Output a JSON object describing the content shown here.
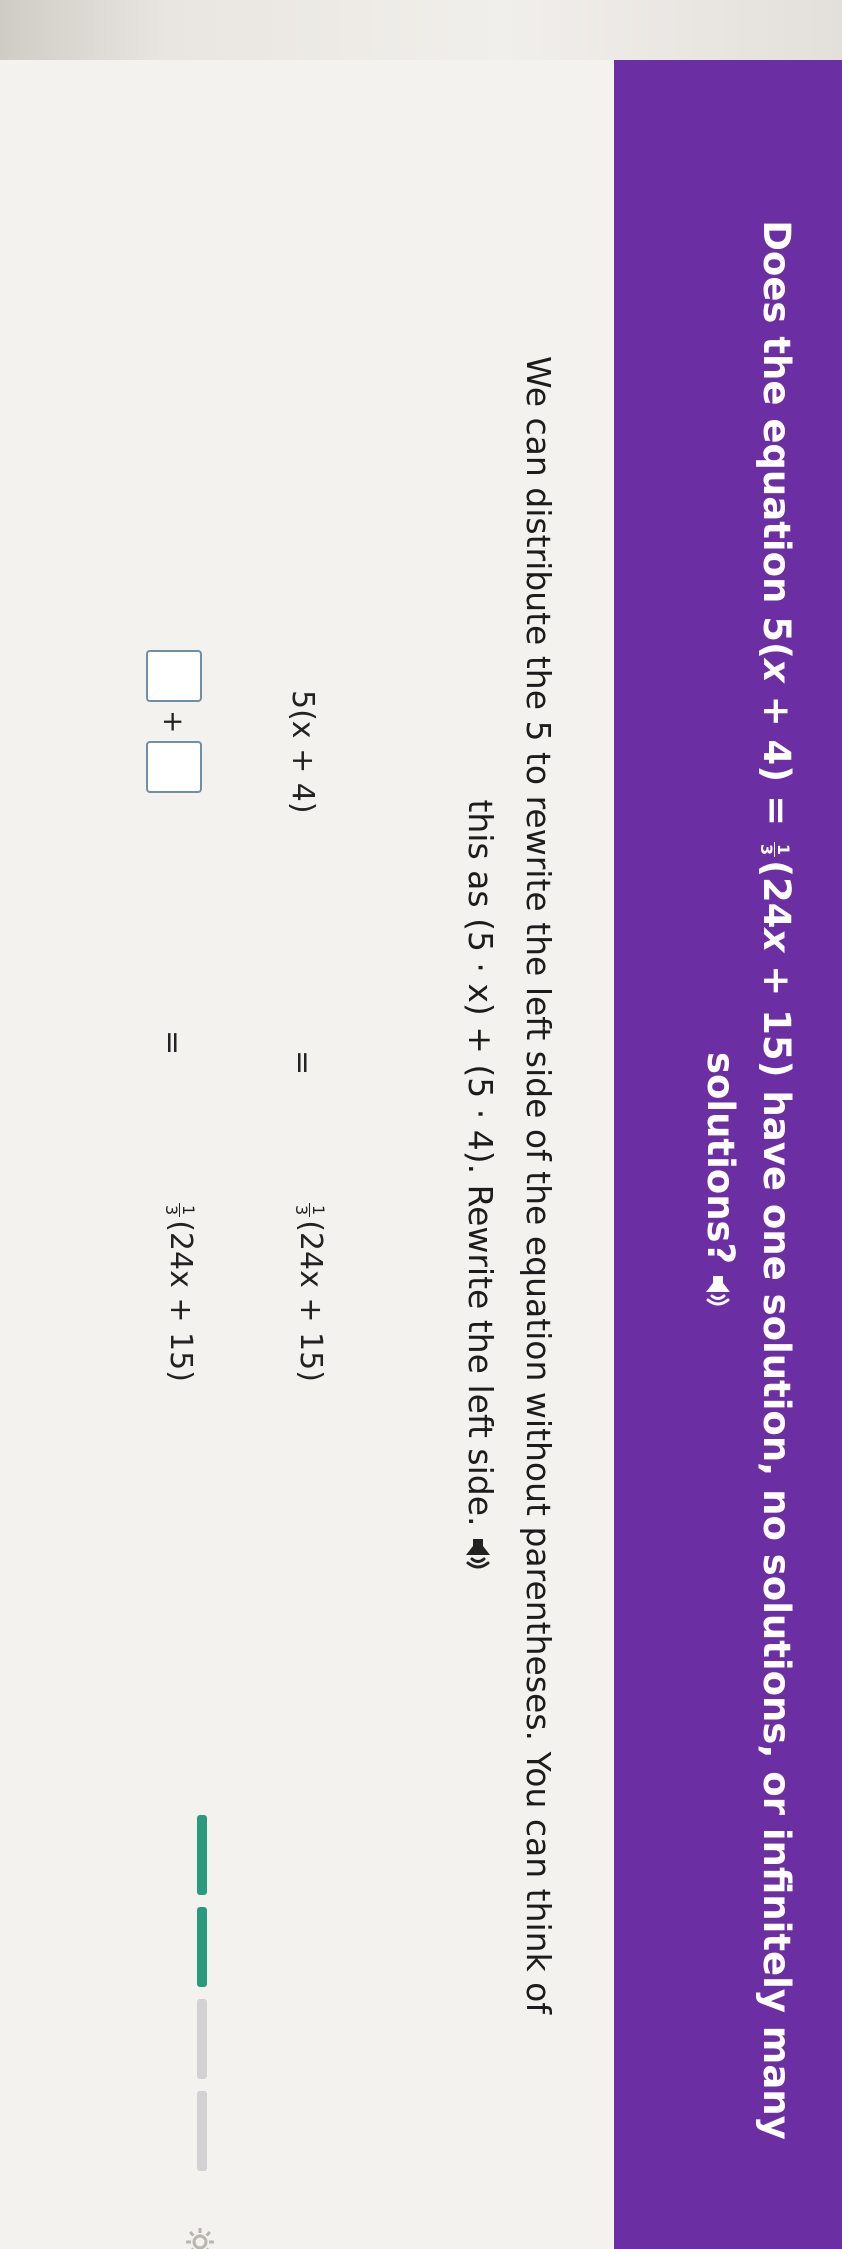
{
  "question": {
    "line1_before": "Does the equation 5(",
    "line1_var": "x",
    "line1_mid": " + 4) = ",
    "line1_frac_num": "1",
    "line1_frac_den": "3",
    "line1_after_a": "(24",
    "line1_var2": "x",
    "line1_after_b": " + 15) have one solution, no solutions, or infinitely many",
    "line2": "solutions?"
  },
  "instruction": {
    "line1": "We can distribute the 5 to rewrite the left side of the equation without parentheses. You can think of",
    "line2": "this as (5 · x) + (5 · 4). Rewrite the left side."
  },
  "equation_rows": [
    {
      "left": "5(x + 4)",
      "sign": "=",
      "frac_num": "1",
      "frac_den": "3",
      "right": "(24x + 15)"
    },
    {
      "plus": "+",
      "sign": "=",
      "frac_num": "1",
      "frac_den": "3",
      "right": "(24x + 15)"
    }
  ],
  "inputs": {
    "first_term_value": "",
    "second_term_value": ""
  },
  "icons": {
    "question_audio": "speaker-icon",
    "instruction_audio": "speaker-icon",
    "settings": "gear-icon"
  },
  "progress": {
    "completed_segments": 2,
    "total_segments": 4
  },
  "colors": {
    "header": "#6b2fa3",
    "progress_done": "#2a9a7e",
    "progress_todo": "#d2d2d2",
    "input_border": "#6f8fa8"
  }
}
